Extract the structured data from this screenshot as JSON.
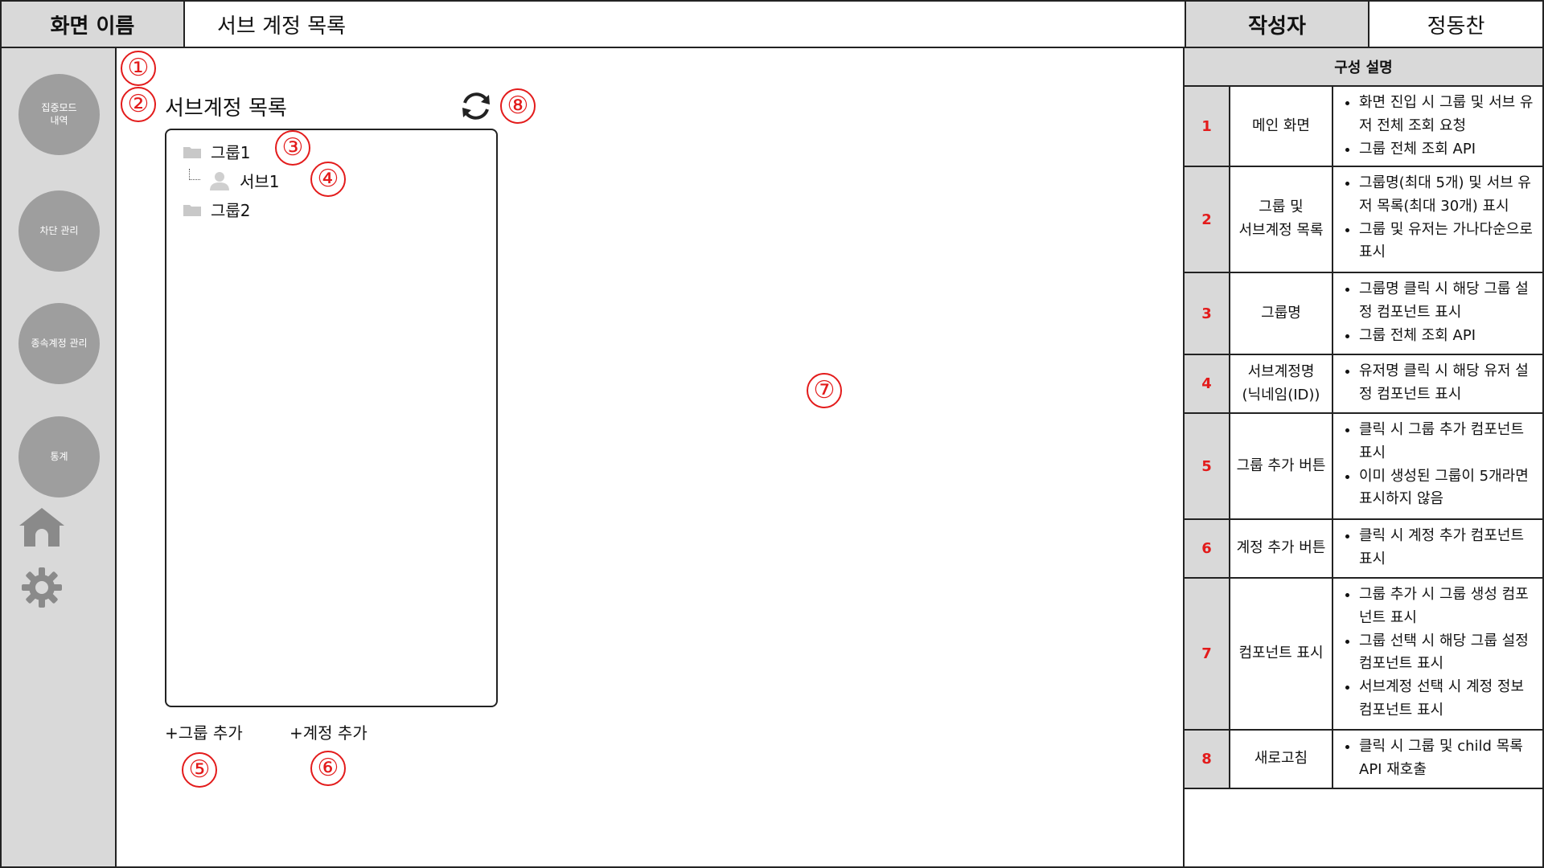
{
  "header": {
    "screen_label": "화면 이름",
    "screen_title": "서브 계정 목록",
    "author_label": "작성자",
    "author_name": "정동찬"
  },
  "sidebar": {
    "items": [
      {
        "label": "집중모드\n내역"
      },
      {
        "label": "차단 관리"
      },
      {
        "label": "종속계정 관리"
      },
      {
        "label": "통계"
      }
    ],
    "icons": [
      "home-icon",
      "gear-icon"
    ]
  },
  "main": {
    "list_title": "서브계정 목록",
    "markers": [
      "①",
      "②",
      "③",
      "④",
      "⑤",
      "⑥",
      "⑦",
      "⑧"
    ],
    "tree": [
      {
        "type": "group",
        "label": "그룹1"
      },
      {
        "type": "sub",
        "label": "서브1"
      },
      {
        "type": "group",
        "label": "그룹2"
      }
    ],
    "add_group_label": "+그룹 추가",
    "add_account_label": "+계정 추가"
  },
  "description": {
    "title": "구성 설명",
    "rows": [
      {
        "num": "1",
        "name": "메인 화면",
        "items": [
          "화면 진입 시 그룹 및 서브 유저 전체 조회 요청",
          "그룹 전체 조회 API"
        ]
      },
      {
        "num": "2",
        "name": "그룹 및\n서브계정 목록",
        "items": [
          "그룹명(최대 5개) 및 서브 유저 목록(최대 30개) 표시",
          "그룹 및 유저는 가나다순으로 표시"
        ]
      },
      {
        "num": "3",
        "name": "그룹명",
        "items": [
          "그룹명 클릭 시 해당 그룹 설정 컴포넌트 표시",
          "그룹 전체 조회 API"
        ]
      },
      {
        "num": "4",
        "name": "서브계정명\n(닉네임(ID))",
        "items": [
          "유저명 클릭 시 해당 유저 설정 컴포넌트 표시"
        ]
      },
      {
        "num": "5",
        "name": "그룹 추가 버튼",
        "items": [
          "클릭 시 그룹 추가 컴포넌트 표시",
          "이미 생성된 그룹이 5개라면 표시하지 않음"
        ]
      },
      {
        "num": "6",
        "name": "계정 추가 버튼",
        "items": [
          "클릭 시 계정 추가 컴포넌트 표시"
        ]
      },
      {
        "num": "7",
        "name": "컴포넌트 표시",
        "items": [
          "그룹 추가 시 그룹 생성 컴포넌트 표시",
          "그룹 선택 시 해당 그룹 설정 컴포넌트 표시",
          "서브계정 선택 시 계정 정보 컴포넌트 표시"
        ]
      },
      {
        "num": "8",
        "name": "새로고침",
        "items": [
          "클릭 시 그룹 및 child 목록 API 재호출"
        ]
      }
    ]
  },
  "colors": {
    "marker_red": "#e31b1b",
    "sidebar_bg": "#d9d9d9",
    "nav_circle": "#9e9e9e"
  }
}
